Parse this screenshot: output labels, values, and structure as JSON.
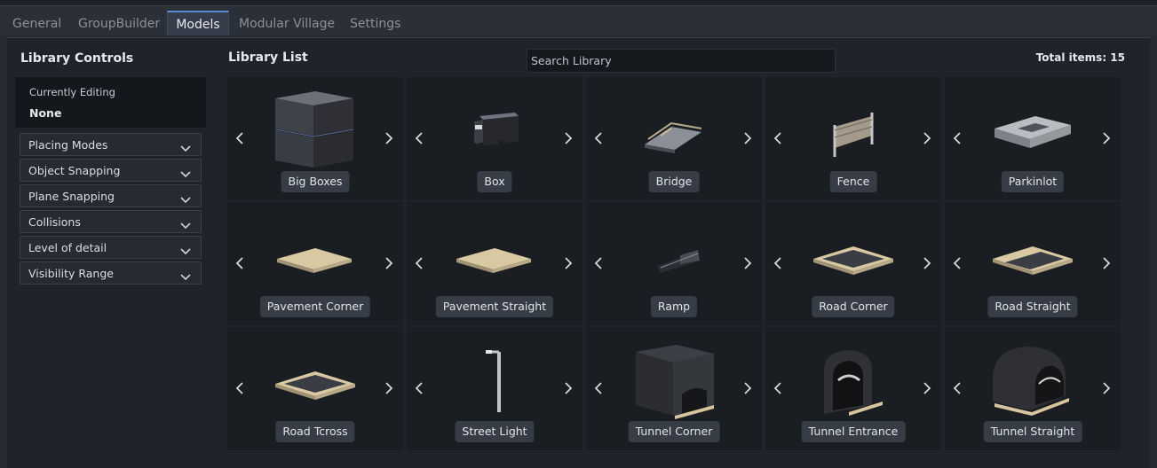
{
  "tabs": [
    {
      "label": "General",
      "active": false
    },
    {
      "label": "GroupBuilder",
      "active": false
    },
    {
      "label": "Models",
      "active": true
    },
    {
      "label": "Modular Village",
      "active": false
    },
    {
      "label": "Settings",
      "active": false
    }
  ],
  "sidebar": {
    "title": "Library Controls",
    "currently_editing_label": "Currently Editing",
    "currently_editing_value": "None",
    "sections": [
      {
        "label": "Placing Modes",
        "icon": "chevron-down-icon"
      },
      {
        "label": "Object Snapping",
        "icon": "chevron-down-icon"
      },
      {
        "label": "Plane Snapping",
        "icon": "chevron-down-icon"
      },
      {
        "label": "Collisions",
        "icon": "chevron-down-icon"
      },
      {
        "label": "Level of detail",
        "icon": "chevron-down-icon"
      },
      {
        "label": "Visibility Range",
        "icon": "chevron-down-icon"
      }
    ]
  },
  "library": {
    "title": "Library List",
    "search_placeholder": "Search Library",
    "total_label": "Total items: 15",
    "items": [
      {
        "name": "Big Boxes",
        "preview": "big-boxes"
      },
      {
        "name": "Box",
        "preview": "box"
      },
      {
        "name": "Bridge",
        "preview": "bridge"
      },
      {
        "name": "Fence",
        "preview": "fence"
      },
      {
        "name": "Parkinlot",
        "preview": "parkinglot"
      },
      {
        "name": "Pavement Corner",
        "preview": "pavement"
      },
      {
        "name": "Pavement Straight",
        "preview": "pavement"
      },
      {
        "name": "Ramp",
        "preview": "ramp"
      },
      {
        "name": "Road Corner",
        "preview": "road"
      },
      {
        "name": "Road Straight",
        "preview": "road-straight"
      },
      {
        "name": "Road Tcross",
        "preview": "road"
      },
      {
        "name": "Street Light",
        "preview": "streetlight"
      },
      {
        "name": "Tunnel Corner",
        "preview": "tunnel-corner"
      },
      {
        "name": "Tunnel Entrance",
        "preview": "tunnel-entrance"
      },
      {
        "name": "Tunnel Straight",
        "preview": "tunnel-straight"
      }
    ]
  },
  "colors": {
    "accent": "#5a8bd6",
    "panel_bg": "#1f242c",
    "cell_bg": "#1a1d21",
    "caption_bg": "#373d47"
  }
}
